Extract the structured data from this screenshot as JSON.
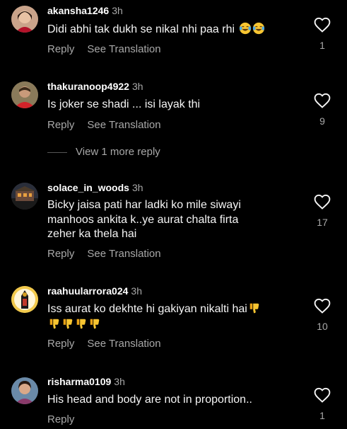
{
  "comments": [
    {
      "username": "akansha1246",
      "time": "3h",
      "text": "Didi abhi tak dukh se nikal nhi paa rhi",
      "text_line2": "",
      "emojis": [
        "laughing-tears",
        "laughing-tears"
      ],
      "reply_label": "Reply",
      "translate_label": "See Translation",
      "likes": "1"
    },
    {
      "username": "thakuranoop4922",
      "time": "3h",
      "text": "Is joker se shadi ... isi layak thi",
      "reply_label": "Reply",
      "translate_label": "See Translation",
      "likes": "9",
      "more_replies": "View 1 more reply"
    },
    {
      "username": "solace_in_woods",
      "time": "3h",
      "text_lines": [
        "Bicky jaisa pati har ladki ko mile siwayi",
        "manhoos ankita k..ye aurat chalta firta",
        "zeher ka thela hai"
      ],
      "reply_label": "Reply",
      "translate_label": "See Translation",
      "likes": "17"
    },
    {
      "username": "raahuularrora024",
      "time": "3h",
      "text": "Iss aurat ko dekhte hi gakiyan nikalti hai",
      "emojis": [
        "thumbs-down",
        "thumbs-down",
        "thumbs-down",
        "thumbs-down",
        "thumbs-down"
      ],
      "reply_label": "Reply",
      "translate_label": "See Translation",
      "likes": "10"
    },
    {
      "username": "risharma0109",
      "time": "3h",
      "text": "His head and body are not in proportion..",
      "reply_label": "Reply",
      "likes": "1"
    }
  ],
  "colors": {
    "background": "#000000",
    "text": "#f5f5f5",
    "muted": "#a8a8a8"
  }
}
